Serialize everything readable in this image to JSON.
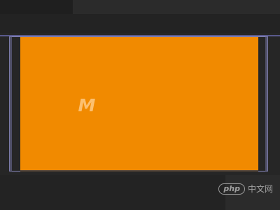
{
  "logo": {
    "text": "M"
  },
  "watermark": {
    "badge": "php",
    "label": "中文网"
  },
  "colors": {
    "background": "#232323",
    "card": "#f18a00",
    "selection": "#8c8cc0"
  }
}
